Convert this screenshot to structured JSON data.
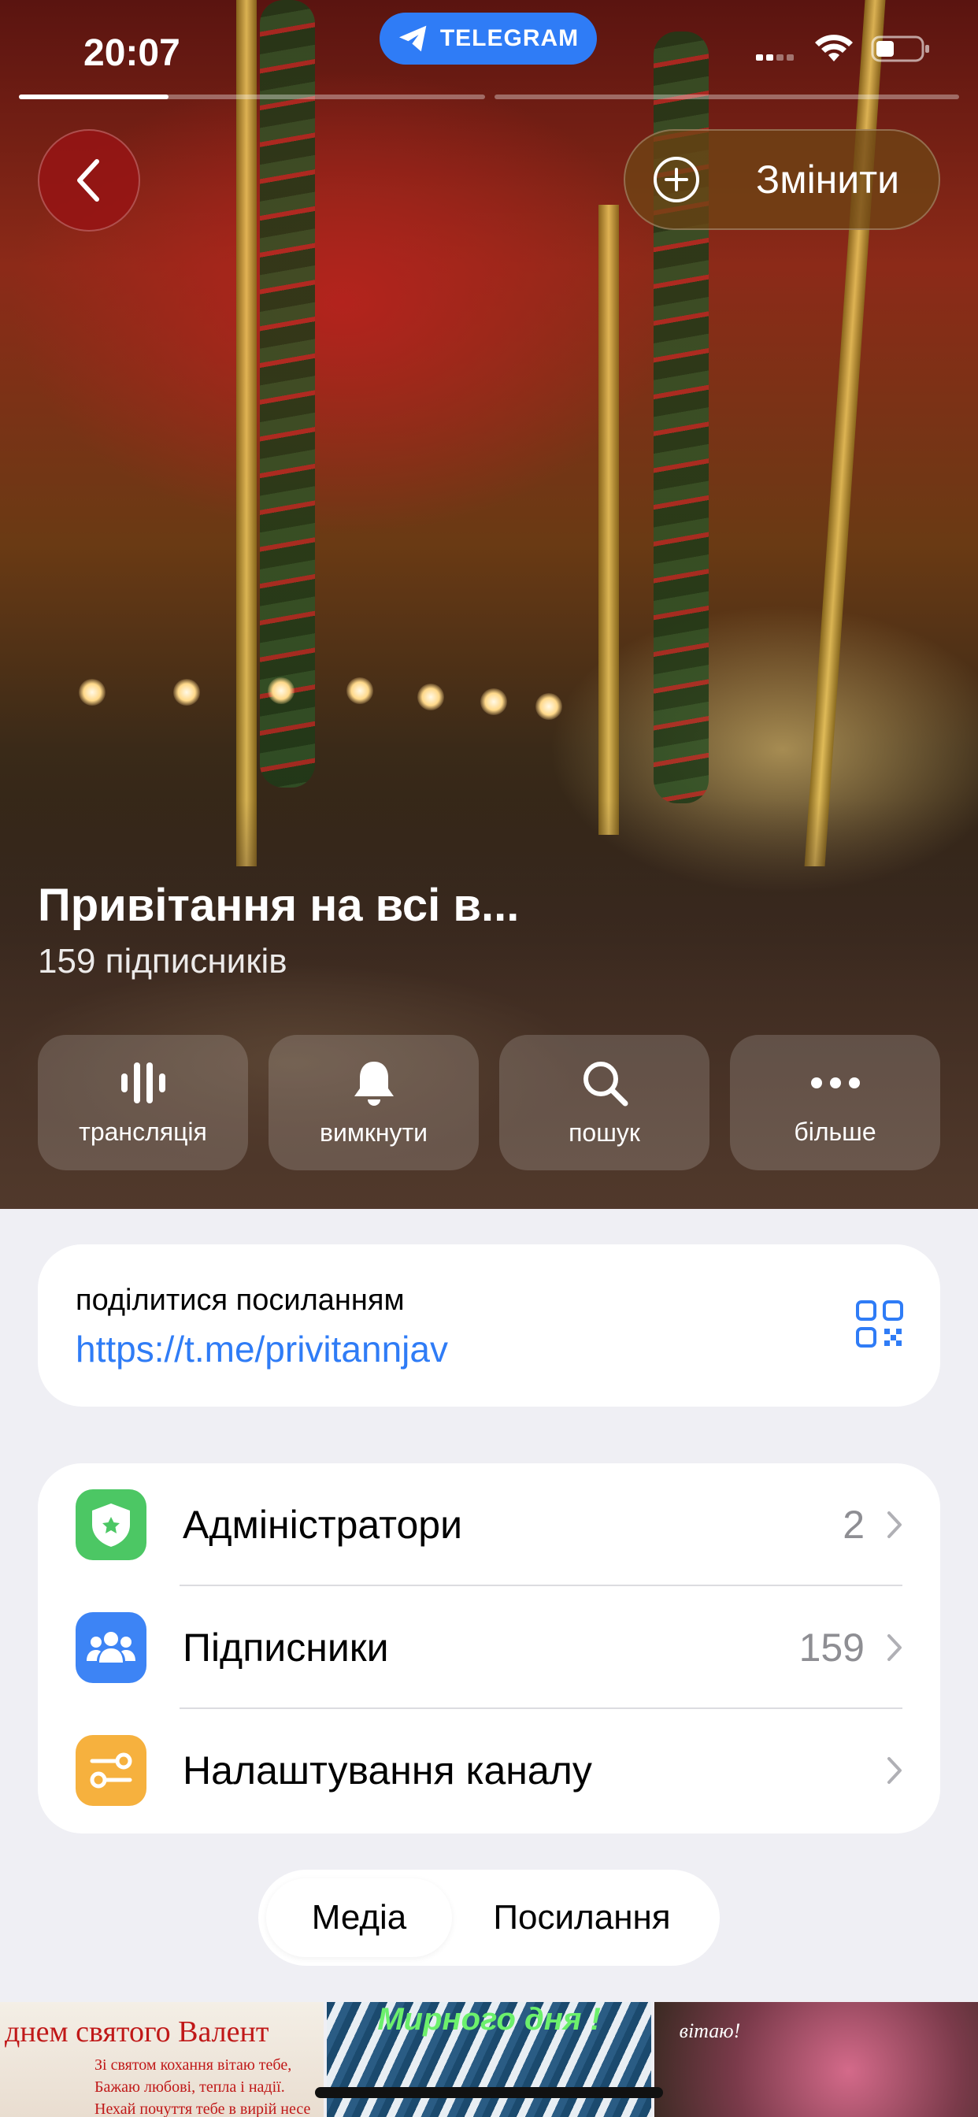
{
  "status_bar": {
    "time": "20:07",
    "source_label": "TELEGRAM"
  },
  "story_progress": [
    1.0,
    0.0,
    0.0
  ],
  "header": {
    "edit_label": "Змінити"
  },
  "channel": {
    "title": "Привітання на всі в...",
    "subscribers": "159 підписників"
  },
  "actions": [
    {
      "label": "трансляція",
      "icon": "live-stream-icon"
    },
    {
      "label": "вимкнути",
      "icon": "bell-icon"
    },
    {
      "label": "пошук",
      "icon": "search-icon"
    },
    {
      "label": "більше",
      "icon": "more-icon"
    }
  ],
  "share": {
    "caption": "поділитися посиланням",
    "link": "https://t.me/privitannjav"
  },
  "menu": [
    {
      "label": "Адміністратори",
      "value": "2",
      "icon": "admin-shield-icon",
      "color": "#4cc764"
    },
    {
      "label": "Підписники",
      "value": "159",
      "icon": "subscribers-icon",
      "color": "#3d84f5"
    },
    {
      "label": "Налаштування каналу",
      "value": "",
      "icon": "channel-settings-icon",
      "color": "#f6b13e"
    }
  ],
  "tabs": {
    "media": "Медіа",
    "links": "Посилання"
  },
  "thumbnails": [
    {
      "title": "днем святого Валент",
      "lines": [
        "Зі святом кохання вітаю тебе,",
        "Бажаю любові, тепла і надії.",
        "Нехай почуття тебе в вирій несе"
      ]
    },
    {
      "title": "Мирного дня !"
    },
    {
      "title": "вітаю!"
    }
  ],
  "colors": {
    "accent": "#2f7cf6",
    "background": "#efeff4"
  }
}
